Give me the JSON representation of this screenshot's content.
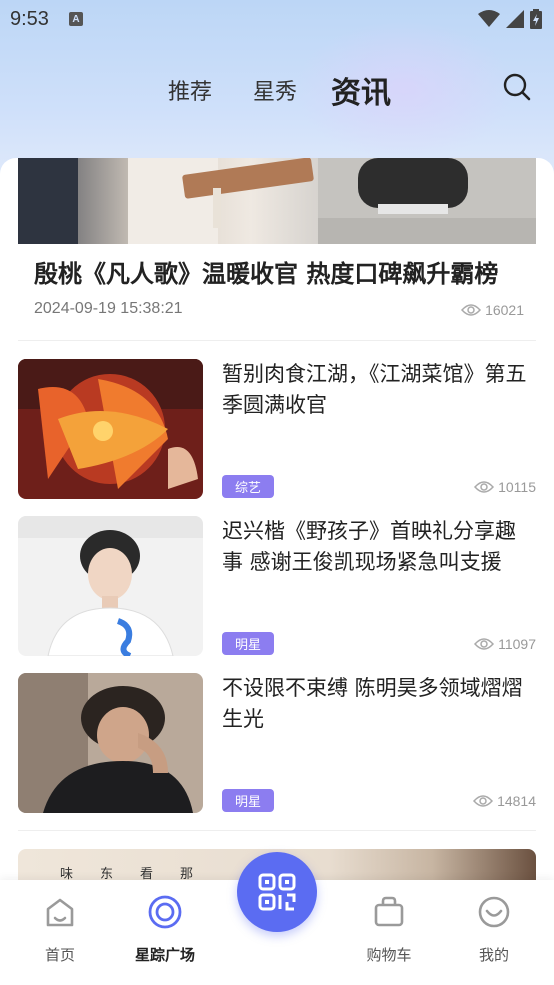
{
  "status_bar": {
    "time": "9:53",
    "notification_icon": "a-icon",
    "icons": [
      "wifi-icon",
      "signal-icon",
      "battery-icon"
    ]
  },
  "header": {
    "tabs": [
      {
        "label": "推荐",
        "active": false
      },
      {
        "label": "星秀",
        "active": false
      },
      {
        "label": "资讯",
        "active": true
      }
    ],
    "search_icon": "search-icon"
  },
  "featured": {
    "title": "殷桃《凡人歌》温暖收官 热度口碑飙升霸榜",
    "date": "2024-09-19 15:38:21",
    "views": "16021"
  },
  "news": [
    {
      "title": "暂别肉食江湖，《江湖菜馆》第五季圆满收官",
      "tag": "综艺",
      "views": "10115"
    },
    {
      "title": "迟兴楷《野孩子》首映礼分享趣事 感谢王俊凯现场紧急叫支援",
      "tag": "明星",
      "views": "11097"
    },
    {
      "title": "不设限不束缚 陈明昊多领域熠熠生光",
      "tag": "明星",
      "views": "14814"
    }
  ],
  "partial_item_text": [
    "味",
    "东",
    "看",
    "那"
  ],
  "tabbar": {
    "items": [
      {
        "label": "首页",
        "icon": "home-icon",
        "active": false
      },
      {
        "label": "星踪广场",
        "icon": "plaza-icon",
        "active": true
      },
      {
        "label": "购物车",
        "icon": "cart-icon",
        "active": false
      },
      {
        "label": "我的",
        "icon": "profile-icon",
        "active": false
      }
    ],
    "center_icon": "qrcode-icon"
  },
  "colors": {
    "accent": "#5b6cf2",
    "tag": "#8c7df0",
    "header_bg": "#cfe0fa"
  }
}
